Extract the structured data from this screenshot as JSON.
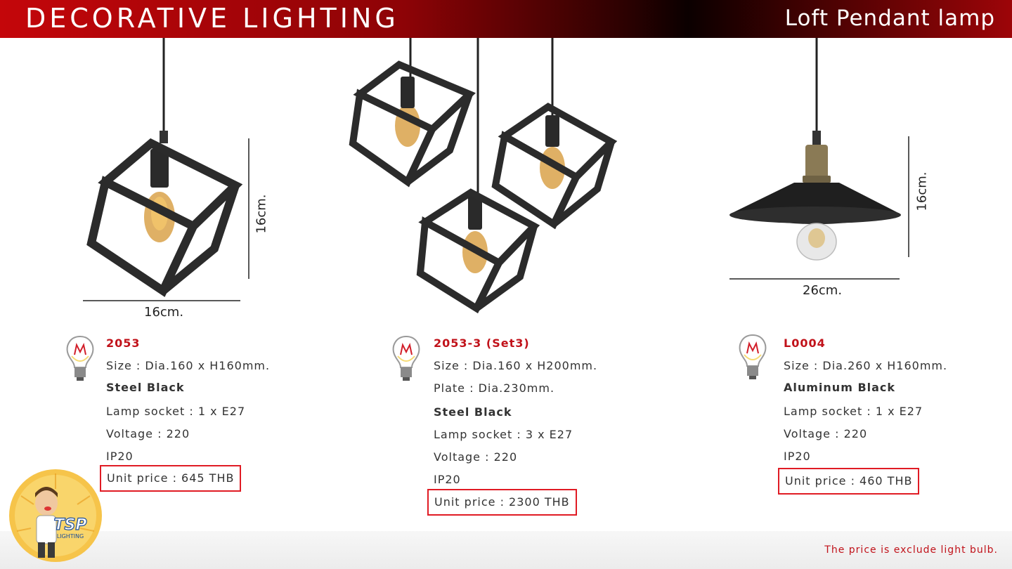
{
  "header": {
    "title": "DECORATIVE LIGHTING",
    "subtitle": "Loft Pendant lamp"
  },
  "products": [
    {
      "code": "2053",
      "size": "Size : Dia.160 x H160mm.",
      "material": "Steel Black",
      "socket": "Lamp socket : 1 x E27",
      "voltage": "Voltage : 220",
      "ip": "IP20",
      "price": "Unit price : 645 THB",
      "dim_width": "16cm.",
      "dim_height": "16cm."
    },
    {
      "code": "2053-3 (Set3)",
      "size": "Size : Dia.160 x H200mm.",
      "plate": "Plate : Dia.230mm.",
      "material": "Steel Black",
      "socket": "Lamp socket : 3 x E27",
      "voltage": "Voltage : 220",
      "ip": "IP20",
      "price": "Unit price : 2300 THB"
    },
    {
      "code": "L0004",
      "size": "Size : Dia.260 x H160mm.",
      "material": "Aluminum Black",
      "socket": "Lamp socket : 1 x E27",
      "voltage": "Voltage : 220",
      "ip": "IP20",
      "price": "Unit price : 460 THB",
      "dim_width": "26cm.",
      "dim_height": "16cm."
    }
  ],
  "footer": {
    "note": "The price is exclude light bulb."
  },
  "logo": {
    "brand": "TSP",
    "sub": "LIGHTING"
  },
  "icons": {
    "bulb": "light-bulb-icon",
    "cube_pendant": "cube-pendant-lamp-image",
    "cube_pendant_set": "cube-pendant-set-image",
    "dish_pendant": "loft-dish-pendant-image"
  },
  "colors": {
    "accent": "#c1121a",
    "price_border": "#e01b24",
    "header_red": "#c4060a"
  }
}
